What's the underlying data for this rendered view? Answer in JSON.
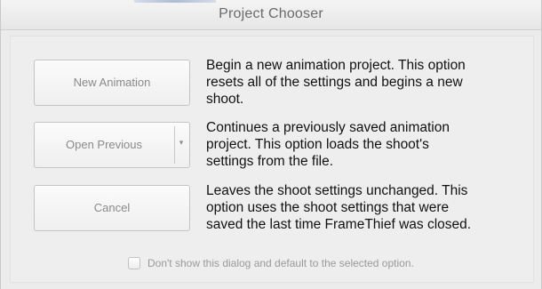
{
  "window": {
    "title": "Project Chooser"
  },
  "options": {
    "new": {
      "button_label": "New Animation",
      "description": "Begin a new animation project. This option\nresets all of the settings and begins a new\nshoot."
    },
    "open": {
      "button_label": "Open Previous",
      "dropdown_icon": "chevron-down-icon",
      "description": "Continues a previously saved animation\nproject. This option loads the shoot's\nsettings from the file."
    },
    "cancel": {
      "button_label": "Cancel",
      "description": "Leaves the shoot settings unchanged. This\noption uses the shoot settings that were\nsaved the last time FrameThief was closed."
    }
  },
  "footer": {
    "checkbox_label": "Don't show this dialog and default to the selected option.",
    "checkbox_checked": false
  },
  "colors": {
    "window_bg": "#ececec",
    "button_text": "#8a8a8a",
    "description_text": "#111111",
    "disabled_text": "#9a9a9a"
  }
}
